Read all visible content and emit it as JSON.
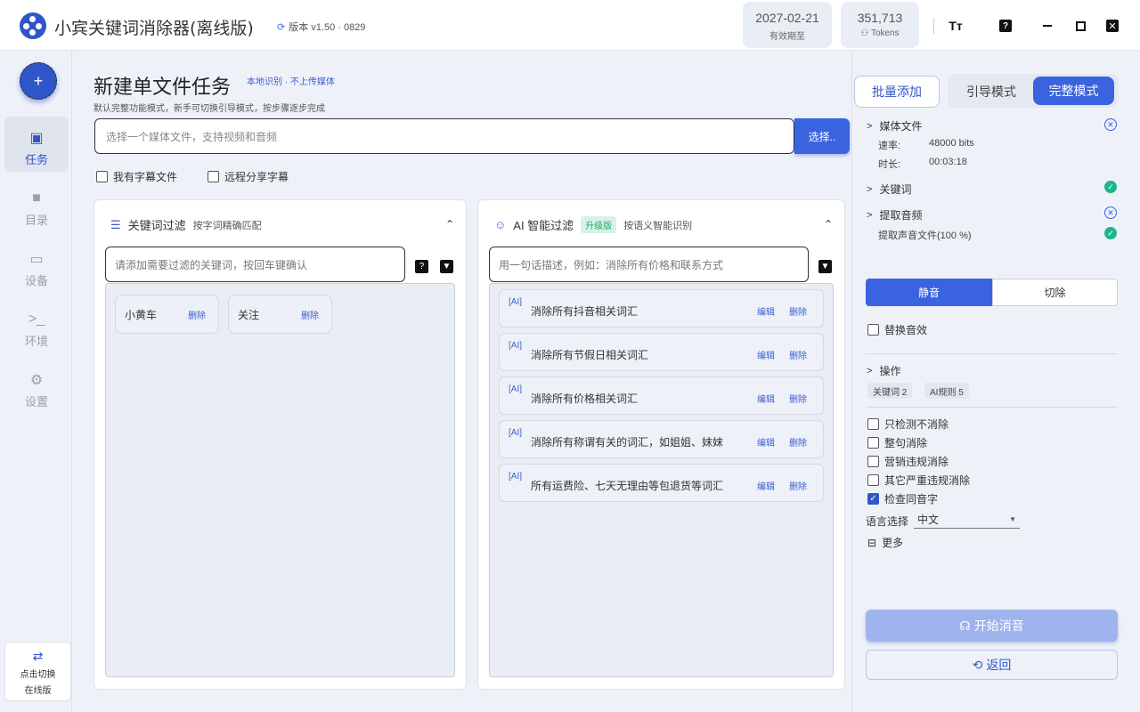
{
  "app": {
    "title": "小宾关键词消除器(离线版)",
    "version": "版本 v1.50 · 0829",
    "expiry_value": "2027-02-21",
    "expiry_label": "有效期至",
    "tokens_value": "351,713",
    "tokens_label": "Tokens"
  },
  "titlebar_icons": {
    "font": "Tт",
    "help": "?",
    "close": "✕"
  },
  "sidebar": {
    "fab": "+",
    "items": [
      {
        "label": "任务",
        "icon": "task-icon",
        "active": true
      },
      {
        "label": "目录",
        "icon": "folder-icon",
        "active": false
      },
      {
        "label": "设备",
        "icon": "device-icon",
        "active": false
      },
      {
        "label": "环境",
        "icon": "terminal-icon",
        "active": false
      },
      {
        "label": "设置",
        "icon": "gear-icon",
        "active": false
      }
    ],
    "switch_line1": "点击切换",
    "switch_line2": "在线版"
  },
  "main": {
    "title": "新建单文件任务",
    "tag": "本地识别 · 不上传媒体",
    "subtitle": "默认完整功能模式，新手可切换引导模式，按步骤逐步完成",
    "media_placeholder": "选择一个媒体文件，支持视频和音频",
    "select_btn": "选择..",
    "chk_subtitle": "我有字幕文件",
    "chk_remote": "远程分享字幕"
  },
  "keyword_panel": {
    "title": "关键词过滤",
    "subtitle": "按字词精确匹配",
    "input_placeholder": "请添加需要过滤的关键词，按回车键确认",
    "help": "?",
    "chips": [
      {
        "text": "小黄车",
        "del": "删除"
      },
      {
        "text": "关注",
        "del": "删除"
      }
    ]
  },
  "ai_panel": {
    "title": "AI 智能过滤",
    "badge": "升级版",
    "subtitle": "按语义智能识别",
    "input_placeholder": "用一句话描述，例如：消除所有价格和联系方式",
    "items": [
      {
        "tag": "[AI]",
        "text": "消除所有抖音相关词汇",
        "edit": "编辑",
        "del": "删除"
      },
      {
        "tag": "[AI]",
        "text": "消除所有节假日相关词汇",
        "edit": "编辑",
        "del": "删除"
      },
      {
        "tag": "[AI]",
        "text": "消除所有价格相关词汇",
        "edit": "编辑",
        "del": "删除"
      },
      {
        "tag": "[AI]",
        "text": "消除所有称谓有关的词汇，如姐姐、妹妹",
        "edit": "编辑",
        "del": "删除"
      },
      {
        "tag": "[AI]",
        "text": "所有运费险、七天无理由等包退货等词汇",
        "edit": "编辑",
        "del": "删除"
      }
    ]
  },
  "right": {
    "batch_add": "批量添加",
    "guide_mode": "引导模式",
    "full_mode": "完整模式",
    "media_file": "媒体文件",
    "rate_label": "速率:",
    "rate_value": "48000 bits",
    "duration_label": "时长:",
    "duration_value": "00:03:18",
    "keywords": "关键词",
    "extract_audio": "提取音频",
    "extract_progress": "提取声音文件(100 %)",
    "mute": "静音",
    "cut": "切除",
    "replace_sfx": "替换音效",
    "operations": "操作",
    "pill_kw": "关键词 2",
    "pill_ai": "AI规则 5",
    "options": [
      {
        "label": "只检测不消除",
        "checked": false
      },
      {
        "label": "整句消除",
        "checked": false
      },
      {
        "label": "营销违规消除",
        "checked": false
      },
      {
        "label": "其它严重违规消除",
        "checked": false
      },
      {
        "label": "检查同音字",
        "checked": true
      }
    ],
    "lang_label": "语言选择",
    "lang_value": "中文",
    "more": "更多",
    "start": "开始消音",
    "back": "返回"
  },
  "colors": {
    "accent": "#3a63e0",
    "accent_light": "#9fb3ec",
    "success": "#1fb58a",
    "background": "#eef1f8"
  }
}
